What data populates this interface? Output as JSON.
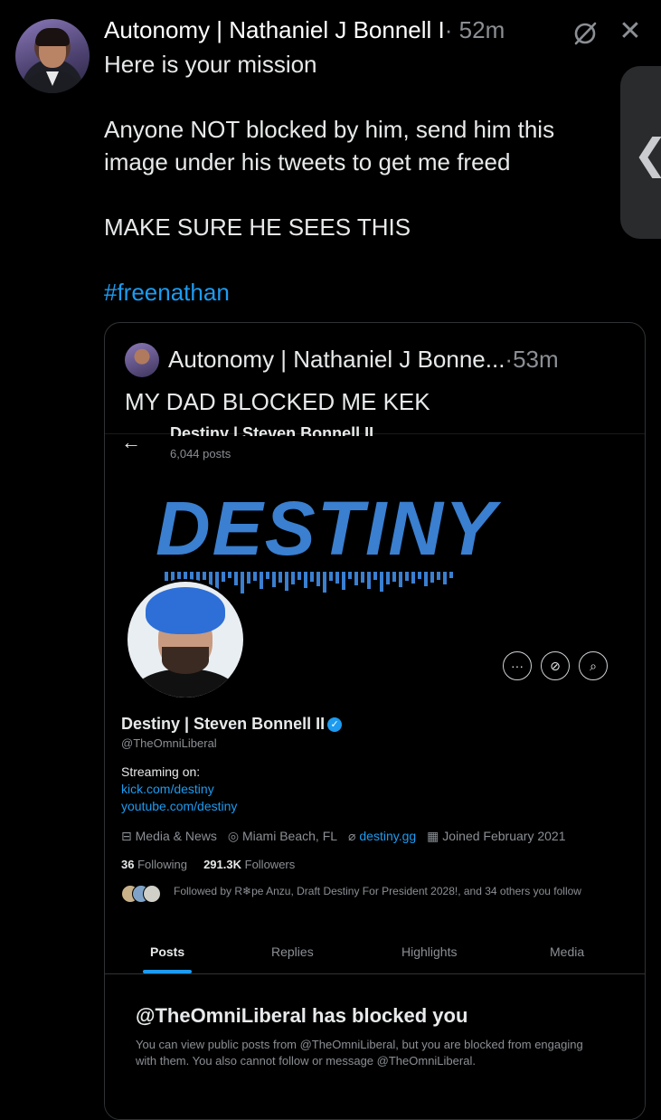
{
  "post": {
    "author": "Autonomy | Nathaniel J Bonnell I",
    "separator": "·",
    "time": "52m",
    "lines": [
      "Here is your mission",
      "Anyone NOT blocked by him, send him this",
      "image under his tweets to get me freed",
      "MAKE SURE HE SEES THIS"
    ],
    "hashtag": "#freenathan"
  },
  "side_handle": {
    "glyph": "❮"
  },
  "quote": {
    "author": "Autonomy | Nathaniel J Bonne...",
    "separator": "·",
    "time": "53m",
    "text": "MY DAD BLOCKED ME KEK"
  },
  "screenshot": {
    "header_name_cut": "Destiny | Steven Bonnell II",
    "post_count": "6,044 posts",
    "banner_word": "DESTINY",
    "profile": {
      "name": "Destiny | Steven Bonnell II",
      "handle": "@TheOmniLiberal",
      "bio_heading": "Streaming on:",
      "bio_links": [
        "kick.com/destiny",
        "youtube.com/destiny"
      ],
      "category": "Media & News",
      "location": "Miami Beach, FL",
      "website": "destiny.gg",
      "joined": "Joined February 2021",
      "following_count": "36",
      "following_label": "Following",
      "followers_count": "291.3K",
      "followers_label": "Followers",
      "followed_by": "Followed by R❄pe Anzu, Draft Destiny For President 2028!, and 34 others you follow"
    },
    "tabs": [
      "Posts",
      "Replies",
      "Highlights",
      "Media"
    ],
    "blocked_title": "@TheOmniLiberal has blocked you",
    "blocked_body": "You can view public posts from @TheOmniLiberal, but you are blocked from engaging with them. You also cannot follow or message @TheOmniLiberal."
  },
  "colors": {
    "accent": "#1d9bf0",
    "banner_blue": "#3a7fd0",
    "muted": "#8b8f94"
  }
}
